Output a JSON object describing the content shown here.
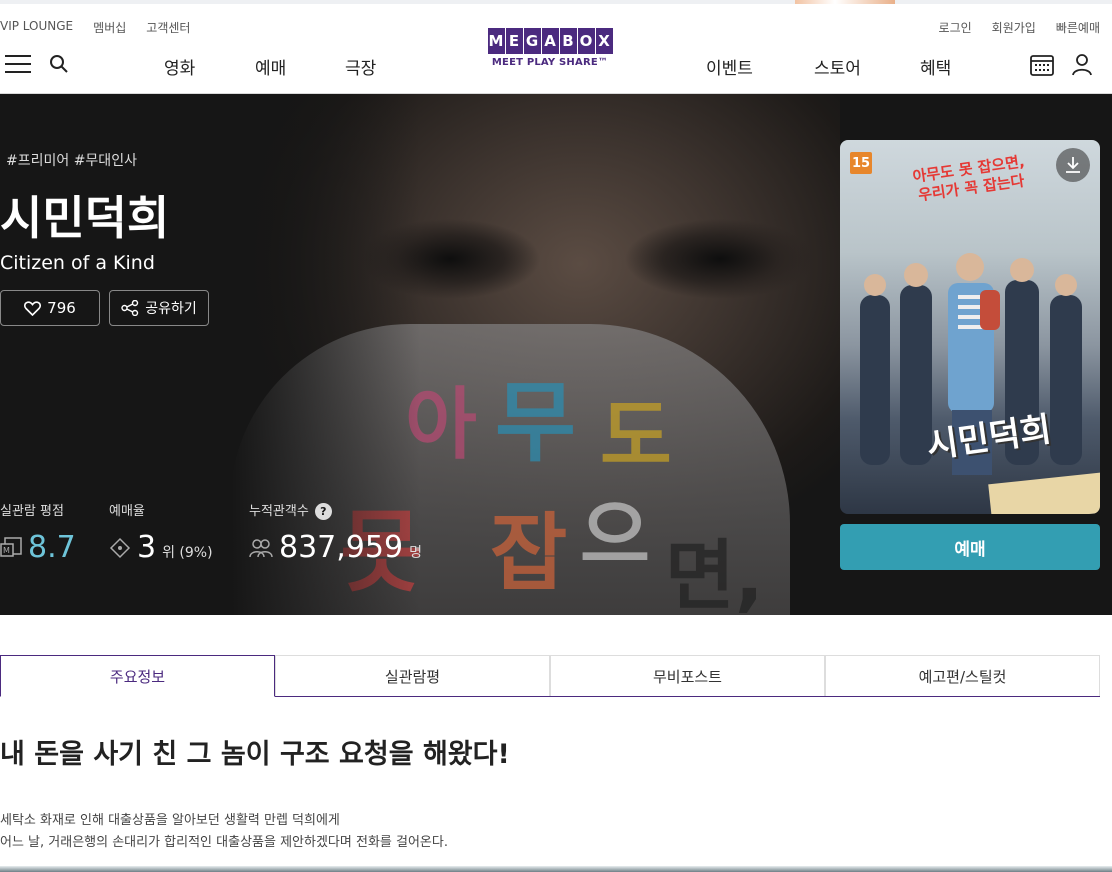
{
  "util_nav": {
    "left": [
      "VIP LOUNGE",
      "멤버십",
      "고객센터"
    ],
    "right": [
      "로그인",
      "회원가입",
      "빠른예매"
    ]
  },
  "logo": {
    "letters": [
      "M",
      "E",
      "G",
      "A",
      "B",
      "O",
      "X"
    ],
    "tagline": "MEET PLAY SHARE™"
  },
  "main_nav": {
    "left": [
      "영화",
      "예매",
      "극장"
    ],
    "right": [
      "이벤트",
      "스토어",
      "혜택"
    ]
  },
  "icons": {
    "menu": "hamburger-menu-icon",
    "search": "search-icon",
    "schedule": "calendar-icon",
    "mypage": "user-icon"
  },
  "movie": {
    "tags": "#프리미어 #무대인사",
    "title_ko": "시민덕희",
    "title_en": "Citizen of a Kind",
    "like_count": "796",
    "share_label": "공유하기",
    "poster": {
      "age_rating": "15",
      "tagline_line1": "아무도 못 잡으면,",
      "tagline_line2": "우리가 꼭 잡는다",
      "title": "시민덕희"
    },
    "book_label": "예매",
    "hero_text": [
      "아",
      "무",
      "도",
      "못",
      "잡",
      "으",
      "면,"
    ]
  },
  "stats": {
    "rating_label": "실관람 평점",
    "rating_value": "8.7",
    "rank_label": "예매율",
    "rank_value": "3",
    "rank_suffix": "위 (9%)",
    "audience_label": "누적관객수",
    "audience_value": "837,959",
    "audience_unit": "명"
  },
  "tabs": [
    "주요정보",
    "실관람평",
    "무비포스트",
    "예고편/스틸컷"
  ],
  "active_tab_index": 0,
  "synopsis": {
    "headline": "내 돈을 사기 친 그 놈이 구조 요청을 해왔다!",
    "line1": "세탁소 화재로 인해 대출상품을 알아보던 생활력 만렙 덕희에게",
    "line2": "어느 날, 거래은행의 손대리가 합리적인 대출상품을 제안하겠다며 전화를 걸어온다."
  },
  "colors": {
    "brand": "#4b2a7f",
    "book_button": "#339eb2",
    "rating": "#6ec4d9",
    "age_badge": "#e7862b"
  }
}
